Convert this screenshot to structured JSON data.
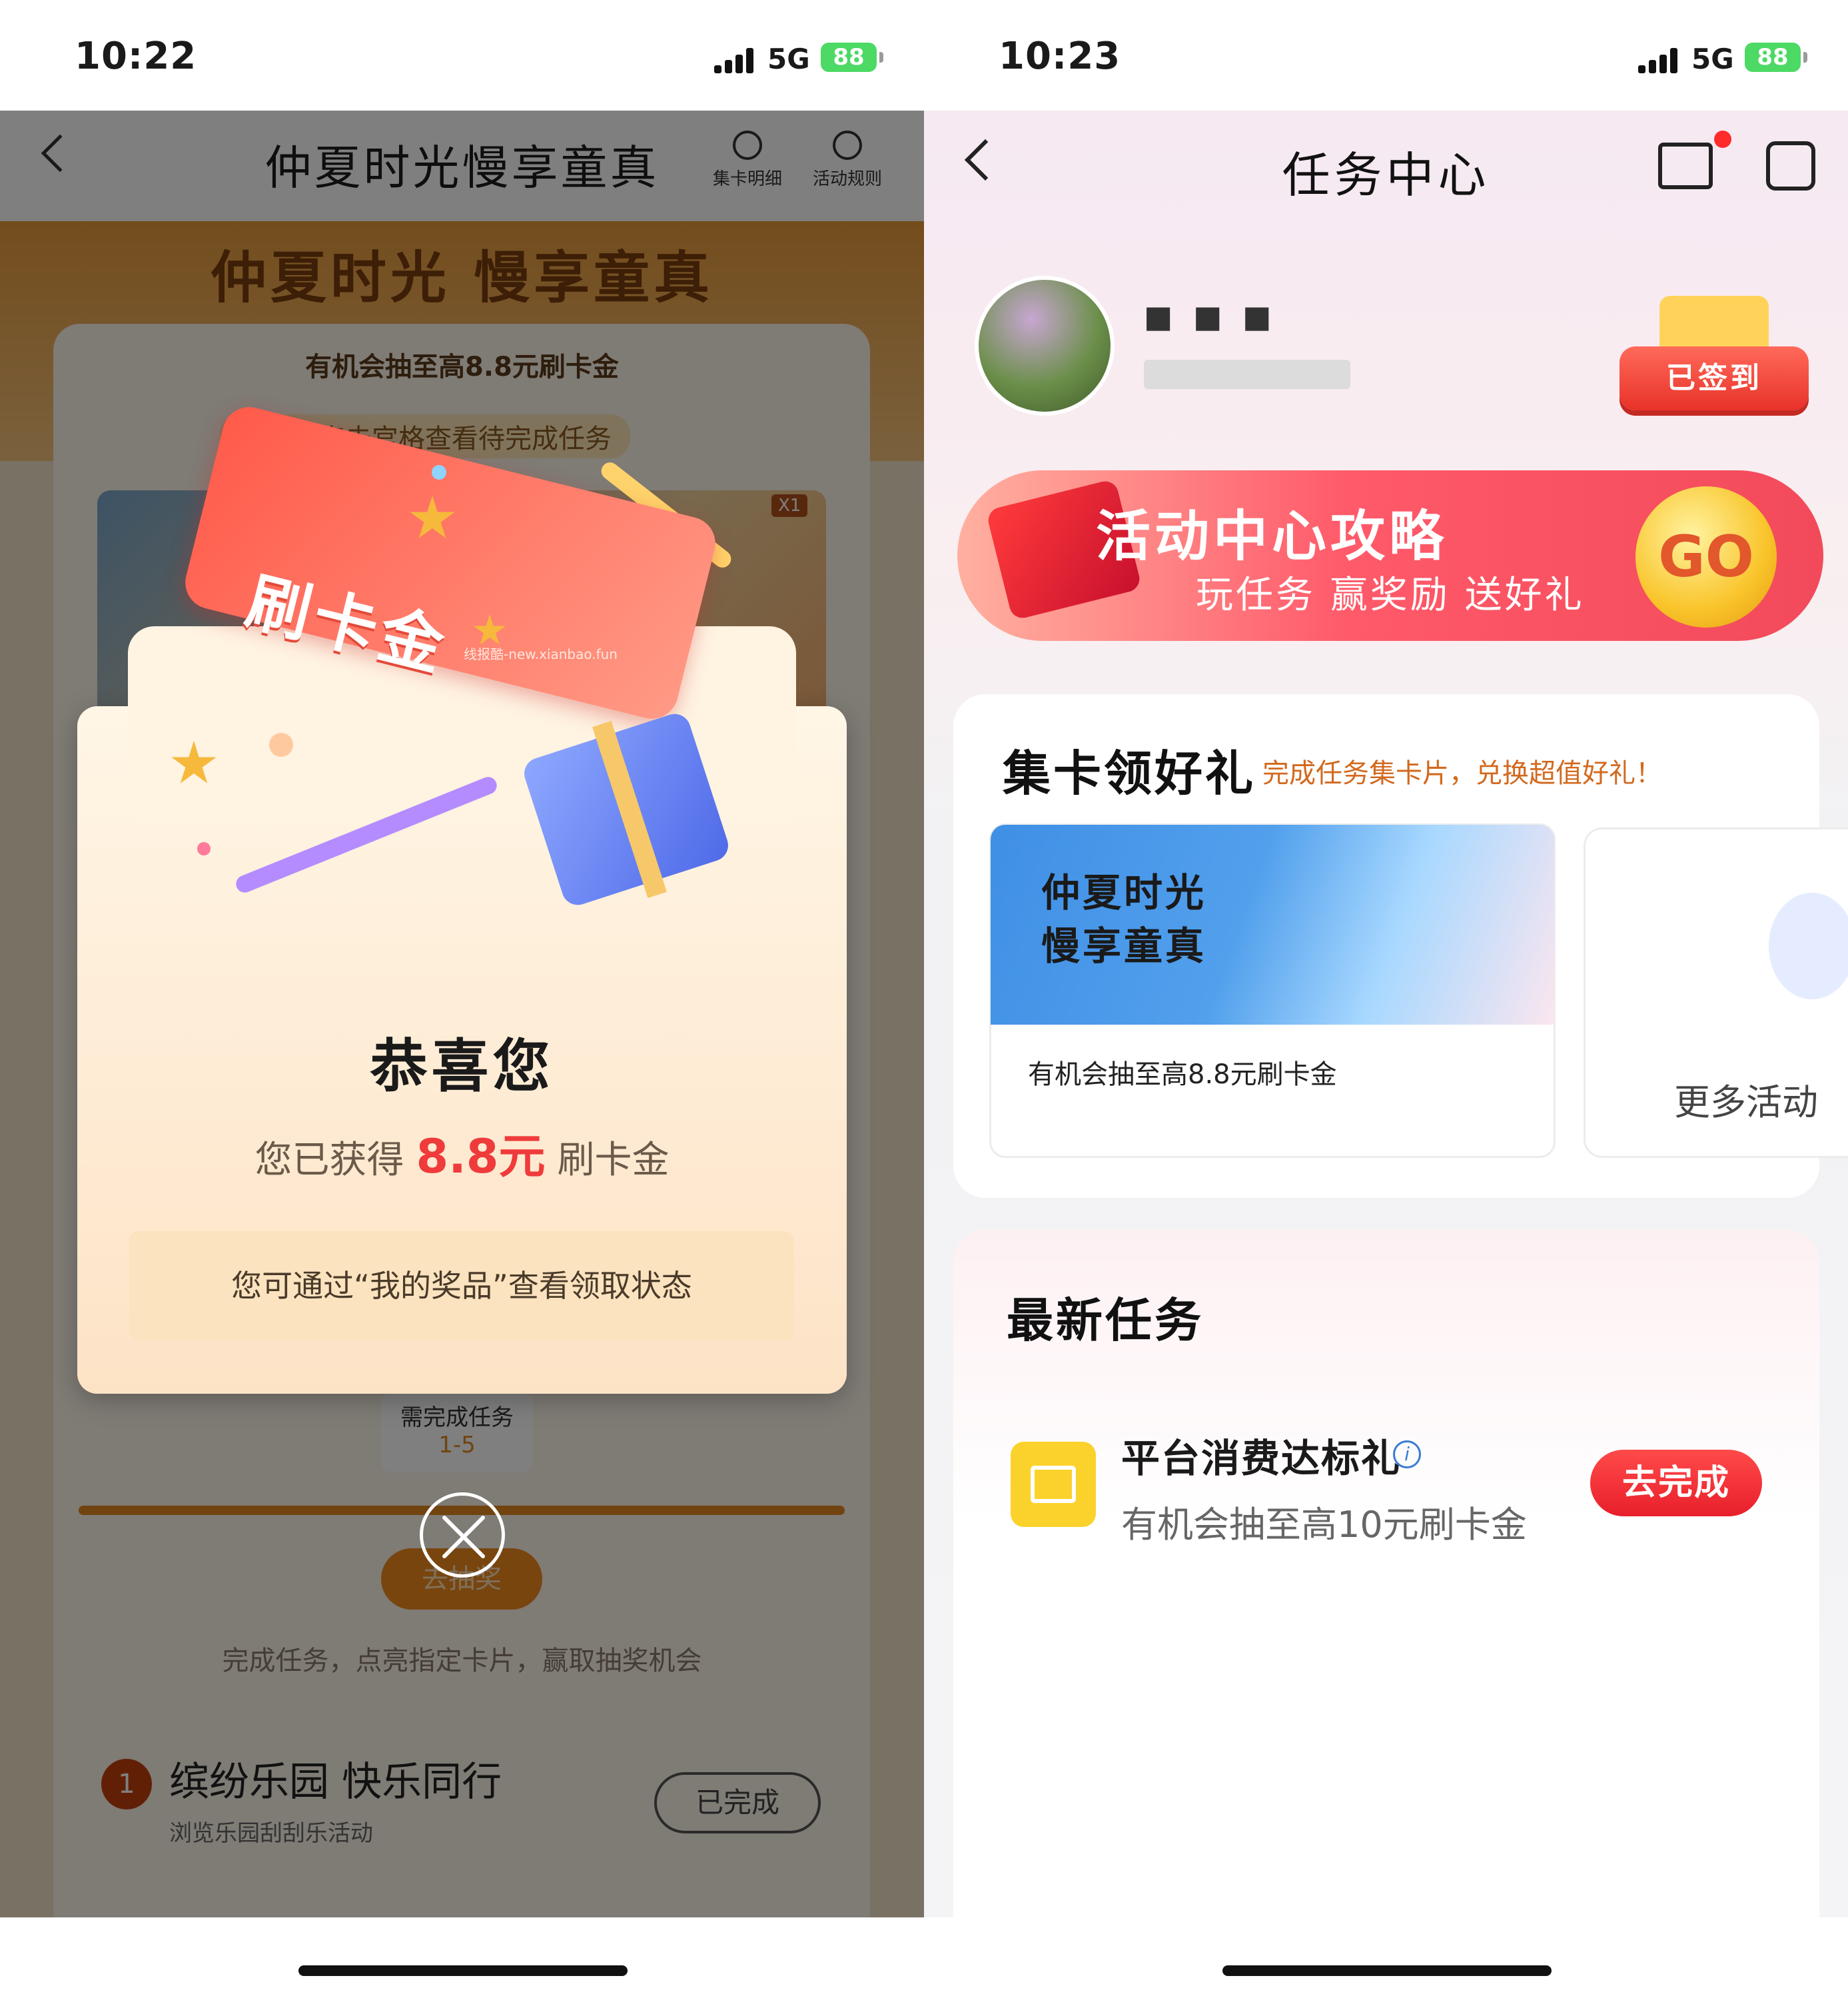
{
  "left": {
    "status": {
      "time": "10:22",
      "network": "5G",
      "battery": "88"
    },
    "nav": {
      "title": "仲夏时光慢享童真",
      "details_label": "集卡明细",
      "rules_label": "活动规则"
    },
    "hero_title": "仲夏时光 慢享童真",
    "chance_text": "有机会抽至高8.8元刷卡金",
    "hint_text": "下滑或点击宫格查看待完成任务",
    "grid_badge": "X1",
    "modal": {
      "ticket_label": "刷卡金",
      "watermark": "线报酷-new.xianbao.fun",
      "title": "恭喜您",
      "prefix": "您已获得",
      "amount": "8.8元",
      "suffix": "刷卡金",
      "note": "您可通过“我的奖品”查看领取状态"
    },
    "requirement": {
      "label": "需完成任务",
      "range": "1-5"
    },
    "draw_button": "去抽奖",
    "description": "完成任务，点亮指定卡片，赢取抽奖机会",
    "task": {
      "number": "1",
      "title": "缤纷乐园 快乐同行",
      "subtitle": "浏览乐园刮刮乐活动",
      "button": "已完成"
    }
  },
  "right": {
    "status": {
      "time": "10:23",
      "network": "5G",
      "battery": "88"
    },
    "nav": {
      "title": "任务中心"
    },
    "user": {
      "name": "■ ■  ■"
    },
    "signed_label": "已签到",
    "banner": {
      "title": "活动中心攻略",
      "subtitle": "玩任务 赢奖励 送好礼",
      "go": "GO"
    },
    "collect": {
      "title": "集卡领好礼",
      "subtitle": "完成任务集卡片，兑换超值好礼！",
      "activity_title": "仲夏时光慢享童真",
      "activity_desc": "有机会抽至高8.8元刷卡金",
      "more_label": "更多活动"
    },
    "latest": {
      "title": "最新任务",
      "task_title": "平台消费达标礼",
      "task_desc": "有机会抽至高10元刷卡金",
      "task_button": "去完成"
    }
  },
  "colors": {
    "accent_red": "#ef3b3b",
    "battery_green": "#4cd964",
    "banner_red": "#f24a5a",
    "task_button": "#e81f2a"
  }
}
